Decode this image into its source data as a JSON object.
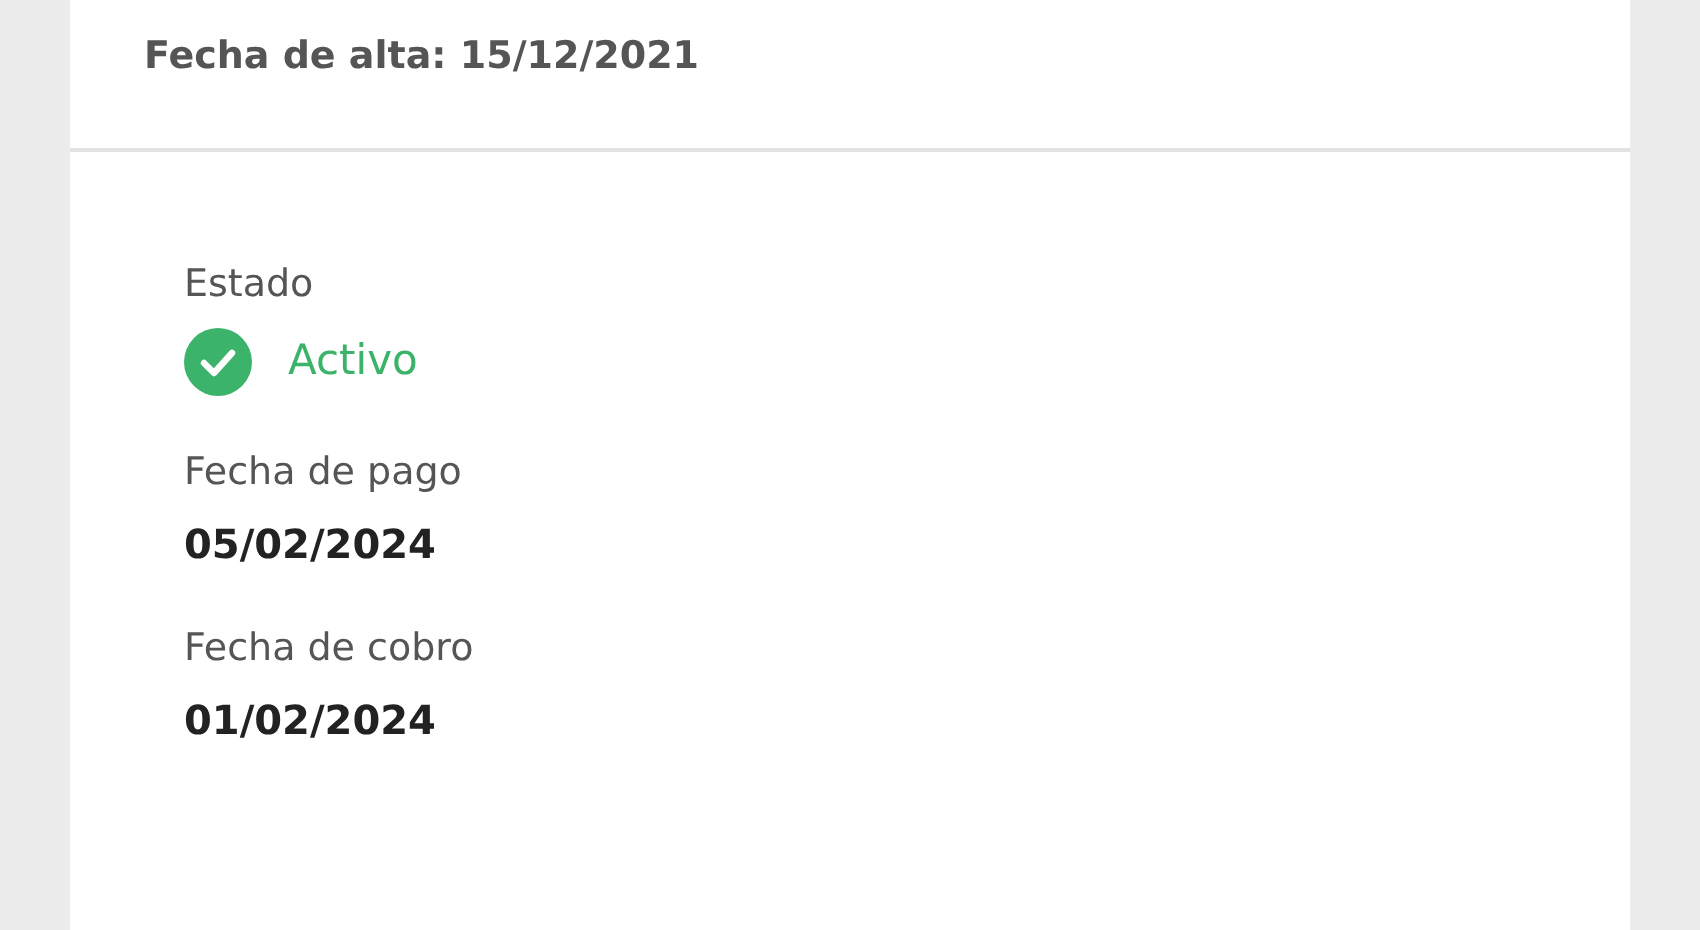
{
  "header": {
    "registration": "Fecha de alta: 15/12/2021"
  },
  "details": [
    {
      "kind": "status",
      "label": "Estado",
      "value": "Activo",
      "active": true
    },
    {
      "kind": "text",
      "label": "Fecha de pago",
      "value": "05/02/2024"
    },
    {
      "kind": "text",
      "label": "Fecha de cobro",
      "value": "01/02/2024"
    }
  ]
}
